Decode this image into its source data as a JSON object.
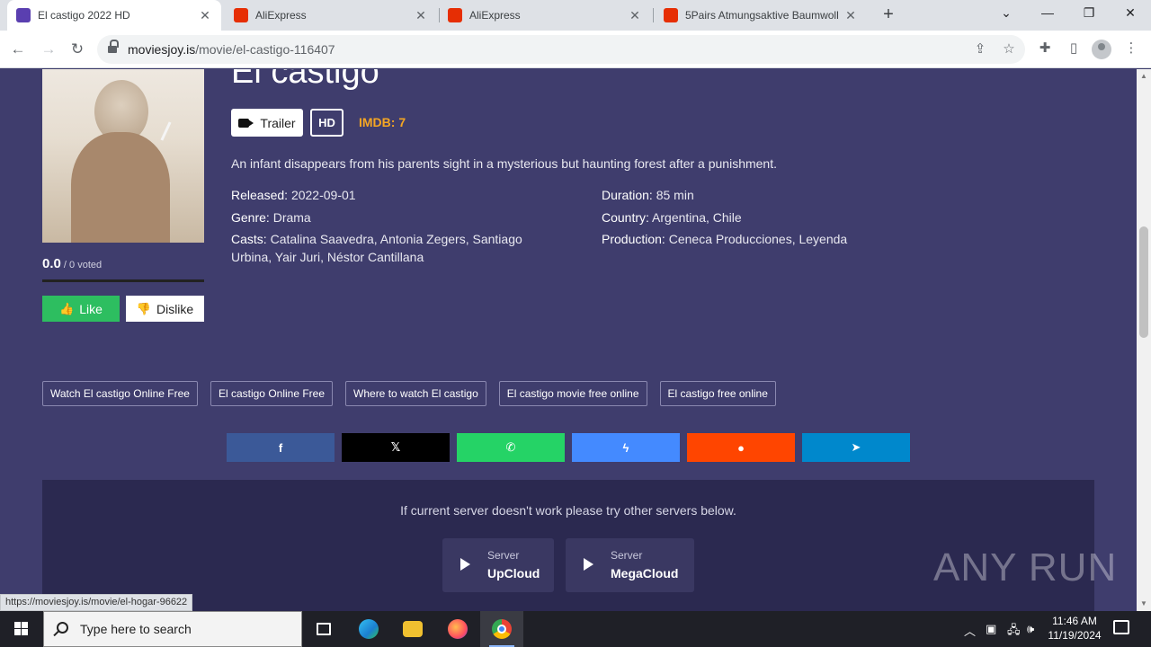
{
  "browser": {
    "tabs": [
      {
        "title": "El castigo 2022 HD",
        "active": true
      },
      {
        "title": "AliExpress",
        "active": false
      },
      {
        "title": "AliExpress",
        "active": false
      },
      {
        "title": "5Pairs Atmungsaktive Baumwoll",
        "active": false
      }
    ],
    "close_glyph": "✕",
    "new_tab_glyph": "+",
    "url_host": "moviesjoy.is",
    "url_path": "/movie/el-castigo-116407",
    "status_url": "https://moviesjoy.is/movie/el-hogar-96622"
  },
  "movie": {
    "title": "El castigo",
    "trailer_label": "Trailer",
    "quality": "HD",
    "imdb": "IMDB: 7",
    "description": "An infant disappears from his parents sight in a mysterious but haunting forest after a punishment.",
    "released_key": "Released:",
    "released": "2022-09-01",
    "genre_key": "Genre:",
    "genre": "Drama",
    "casts_key": "Casts:",
    "casts": "Catalina Saavedra, Antonia Zegers, Santiago Urbina, Yair Juri, Néstor Cantillana",
    "duration_key": "Duration:",
    "duration": "85 min",
    "country_key": "Country:",
    "country": "Argentina, Chile",
    "production_key": "Production:",
    "production": "Ceneca Producciones, Leyenda"
  },
  "rating": {
    "score": "0.0",
    "votes": " / 0 voted",
    "like_label": "Like",
    "dislike_label": "Dislike"
  },
  "tags": [
    "Watch El castigo Online Free",
    "El castigo Online Free",
    "Where to watch El castigo",
    "El castigo movie free online",
    "El castigo free online"
  ],
  "share": [
    {
      "name": "facebook",
      "glyph": "f",
      "color": "#3b5998"
    },
    {
      "name": "x",
      "glyph": "𝕏",
      "color": "#000000"
    },
    {
      "name": "whatsapp",
      "glyph": "✆",
      "color": "#25d366"
    },
    {
      "name": "messenger",
      "glyph": "ϟ",
      "color": "#448aff"
    },
    {
      "name": "reddit",
      "glyph": "●",
      "color": "#ff4500"
    },
    {
      "name": "telegram",
      "glyph": "➤",
      "color": "#0088cc"
    }
  ],
  "servers": {
    "message": "If current server doesn't work please try other servers below.",
    "items": [
      {
        "label": "Server",
        "name": "UpCloud"
      },
      {
        "label": "Server",
        "name": "MegaCloud"
      }
    ]
  },
  "watermark": "ANY RUN",
  "taskbar": {
    "search_placeholder": "Type here to search",
    "time": "11:46 AM",
    "date": "11/19/2024"
  }
}
